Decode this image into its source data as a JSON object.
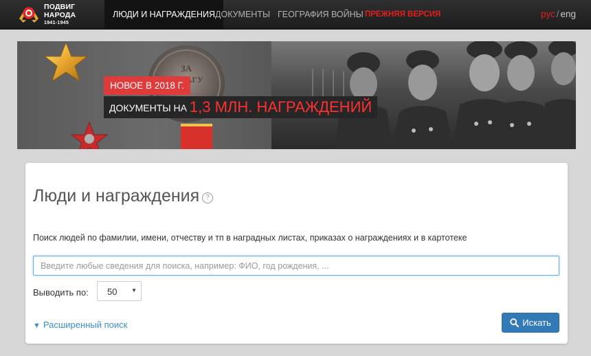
{
  "logo": {
    "line1": "ПОДВИГ",
    "line2": "НАРОДА",
    "years": "1941-1945"
  },
  "nav": {
    "items": [
      {
        "label": "ЛЮДИ И НАГРАЖДЕНИЯ"
      },
      {
        "label": "ДОКУМЕНТЫ"
      },
      {
        "label": "ГЕОГРАФИЯ ВОЙНЫ"
      },
      {
        "label": "ПРЕЖНЯЯ ВЕРСИЯ"
      }
    ],
    "lang_ru": "рус",
    "lang_sep": "/",
    "lang_en": "eng"
  },
  "banner": {
    "badge_new": "НОВОЕ В 2018 Г.",
    "docs_prefix": "ДОКУМЕНТЫ НА ",
    "docs_highlight": "1,3 МЛН. НАГРАЖДЕНИЙ",
    "medal_text_1": "ЗА",
    "medal_text_2": "ОТВАГУ"
  },
  "search_card": {
    "title": "Люди и награждения",
    "help_glyph": "?",
    "description": "Поиск людей по фамилии, имени, отчеству и тп в наградных листах, приказах о награждениях и в картотеке",
    "input_placeholder": "Введите любые сведения для поиска, например: ФИО, год рождения, ...",
    "input_value": "",
    "per_page_label": "Выводить по:",
    "per_page_value": "50",
    "advanced_triangle": "▼",
    "advanced_label": "Расширенный поиск",
    "search_button_label": "Искать"
  },
  "colors": {
    "accent_red": "#e0201e",
    "button_blue": "#337ab7",
    "link_blue": "#3d8ec9"
  },
  "icons": [
    "logo-emblem-icon",
    "help-icon",
    "search-icon",
    "chevron-down-icon",
    "triangle-down-icon",
    "gold-star-icon",
    "red-star-icon"
  ]
}
